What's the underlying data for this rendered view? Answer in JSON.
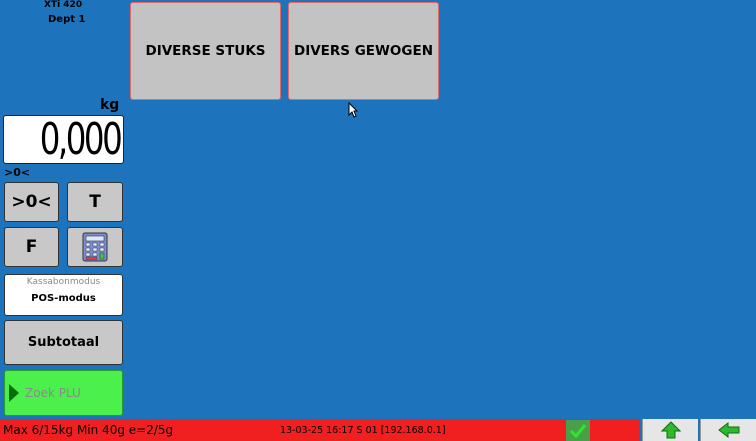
{
  "header": {
    "model": "XTi 420",
    "department": "Dept 1"
  },
  "scale": {
    "unit": "kg",
    "weight": "0,000",
    "zero_indicator": ">0<"
  },
  "buttons": {
    "zero": ">0<",
    "tare": "T",
    "function": "F",
    "keypad_icon": "keypad-icon",
    "subtotal": "Subtotaal",
    "search_plu": "Zoek PLU"
  },
  "mode": {
    "label": "Kassabonmodus",
    "value": "POS-modus"
  },
  "plu_tiles": [
    {
      "label": "DIVERSE STUKS"
    },
    {
      "label": "DIVERS GEWOGEN"
    }
  ],
  "status": {
    "capacity": "Max 6/15kg Min 40g e=2/5g",
    "info": "13-03-25 16:17 S 01 [192.168.0.1]"
  },
  "nav": {
    "up_icon": "arrow-up-icon",
    "back_icon": "arrow-left-icon"
  },
  "colors": {
    "background": "#1e74bc",
    "status_bar": "#f02020",
    "search_button": "#4cf04c",
    "tile": "#c3c3c3",
    "tile_border": "#e06a6a"
  }
}
